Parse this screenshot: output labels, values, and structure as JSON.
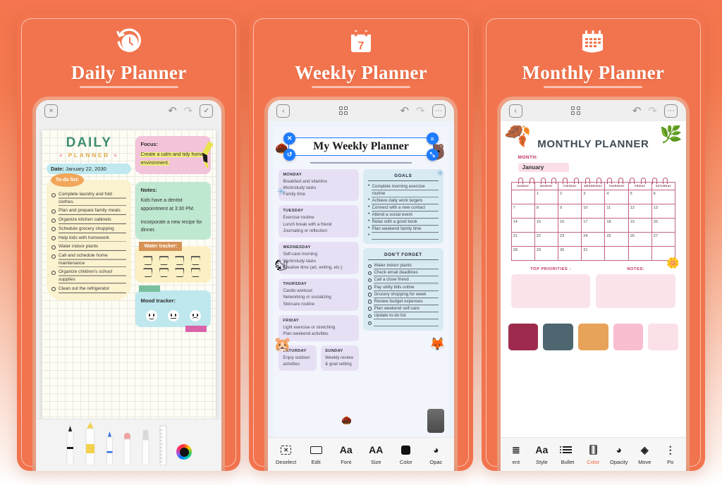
{
  "cards": [
    {
      "title": "Daily Planner",
      "icon": "alarm-clock-icon"
    },
    {
      "title": "Weekly Planner",
      "icon": "calendar-7-icon"
    },
    {
      "title": "Monthly Planner",
      "icon": "calendar-month-icon"
    }
  ],
  "daily": {
    "nav": {
      "close": "×",
      "undo": "↶",
      "redo": "↷",
      "check": "✓"
    },
    "title": "DAILY",
    "subtitle": "PLANNER",
    "date_label": "Date:",
    "date_value": "January 22, 2030",
    "todo_label": "To-do list:",
    "todos": [
      "Complete laundry and fold clothes.",
      "Plan and prepare family meals",
      "Organize kitchen cabinets",
      "Schedule grocery shopping",
      "Help kids with homework",
      "Water indoor plants",
      "Call and schedule home maintenance",
      "Organize children's school supplies",
      "Clean out the refrigerator"
    ],
    "focus_label": "Focus:",
    "focus_text": "Create a calm and tidy home environment.",
    "notes_label": "Notes:",
    "notes": [
      "Kids have a dentist appointment at 3:30 PM.",
      "Incorporate a new recipe for dinner."
    ],
    "water_label": "Water tracker:",
    "water_count": 8,
    "mood_label": "Mood tracker:",
    "moods": [
      "happy-face",
      "neutral-face",
      "sad-face"
    ],
    "tools": [
      "pen-tool",
      "highlighter-tool",
      "fineliner-tool",
      "eraser-tool",
      "brush-tool",
      "ruler-tool",
      "color-wheel"
    ]
  },
  "weekly": {
    "nav": {
      "back": "‹",
      "grid": "grid-icon",
      "undo": "↶",
      "redo": "↷",
      "more": "⋯"
    },
    "title": "My Weekly Planner",
    "handles": {
      "close": "✕",
      "options": "≡",
      "rotate": "↺",
      "resize": "⤡"
    },
    "days": [
      {
        "name": "MONDAY",
        "lines": [
          "Breakfast and vitamins",
          "Work/study tasks",
          "Family time"
        ]
      },
      {
        "name": "TUESDAY",
        "lines": [
          "Exercise routine",
          "Lunch break with a friend",
          "Journaling or reflection"
        ]
      },
      {
        "name": "WEDNESDAY",
        "lines": [
          "Self-care morning",
          "Work/study tasks",
          "Creative time (art, writing, etc.)"
        ]
      },
      {
        "name": "THURSDAY",
        "lines": [
          "Cardio workout",
          "Networking or socializing",
          "Skincare routine"
        ]
      },
      {
        "name": "FRIDAY",
        "lines": [
          "Light exercise or stretching",
          "Plan weekend activities"
        ]
      }
    ],
    "weekend": [
      {
        "name": "SATURDAY",
        "lines": [
          "Enjoy outdoor activities"
        ]
      },
      {
        "name": "SUNDAY",
        "lines": [
          "Weekly review & goal setting"
        ]
      }
    ],
    "goals_title": "GOALS",
    "goals": [
      "Complete morning exercise routine",
      "Achieve daily work targets",
      "Connect with a new contact",
      "Attend a social event",
      "Relax with a good book",
      "Plan weekend family time",
      ""
    ],
    "forget_title": "DON'T FORGET",
    "forget": [
      "Water indoor plants",
      "Check email deadlines",
      "Call a close friend",
      "Pay utility bills online",
      "Grocery shopping for week",
      "Review budget expenses",
      "Plan weekend self-care",
      "Update to-do list",
      ""
    ],
    "toolbar": [
      {
        "label": "Deselect",
        "icon": "deselect-icon",
        "active": false
      },
      {
        "label": "Edit",
        "icon": "keyboard-icon",
        "active": false
      },
      {
        "label": "Font",
        "icon": "font-aa-icon",
        "active": false
      },
      {
        "label": "Size",
        "icon": "size-aa-icon",
        "active": false
      },
      {
        "label": "Color",
        "icon": "color-swatch-icon",
        "active": false
      },
      {
        "label": "Opac",
        "icon": "opacity-icon",
        "active": false
      }
    ]
  },
  "monthly": {
    "nav": {
      "back": "‹",
      "grid": "grid-icon",
      "undo": "↶",
      "redo": "↷",
      "more": "⋯"
    },
    "title": "MONTHLY PLANNER",
    "month_label": "MONTH:",
    "month_value": "January",
    "weekdays": [
      "SUNDAY",
      "MONDAY",
      "TUESDAY",
      "WEDNESDAY",
      "THURSDAY",
      "FRIDAY",
      "SATURDAY"
    ],
    "weeks": [
      [
        "",
        "1",
        "2",
        "3",
        "4",
        "5",
        "6"
      ],
      [
        "7",
        "8",
        "9",
        "10",
        "11",
        "12",
        "13"
      ],
      [
        "14",
        "15",
        "16",
        "17",
        "18",
        "19",
        "20"
      ],
      [
        "21",
        "22",
        "23",
        "24",
        "25",
        "26",
        "27"
      ],
      [
        "28",
        "29",
        "30",
        "31",
        "",
        "",
        ""
      ]
    ],
    "priorities_label": "TOP PRIORITIES :",
    "notes_label": "NOTES:",
    "swatches": [
      "#9e2b4e",
      "#4d6670",
      "#e8a35a",
      "#f9bdd0",
      "#fbe0e8"
    ],
    "toolbar": [
      {
        "label": "ent",
        "icon": "alignment-icon",
        "active": false
      },
      {
        "label": "Style",
        "icon": "font-aa-icon",
        "active": false
      },
      {
        "label": "Bullet",
        "icon": "bullet-list-icon",
        "active": false
      },
      {
        "label": "Color",
        "icon": "color-gradient-icon",
        "active": true
      },
      {
        "label": "Opacity",
        "icon": "opacity-icon",
        "active": false
      },
      {
        "label": "Move",
        "icon": "layers-icon",
        "active": false
      },
      {
        "label": "Po",
        "icon": "position-icon",
        "active": false
      }
    ]
  }
}
